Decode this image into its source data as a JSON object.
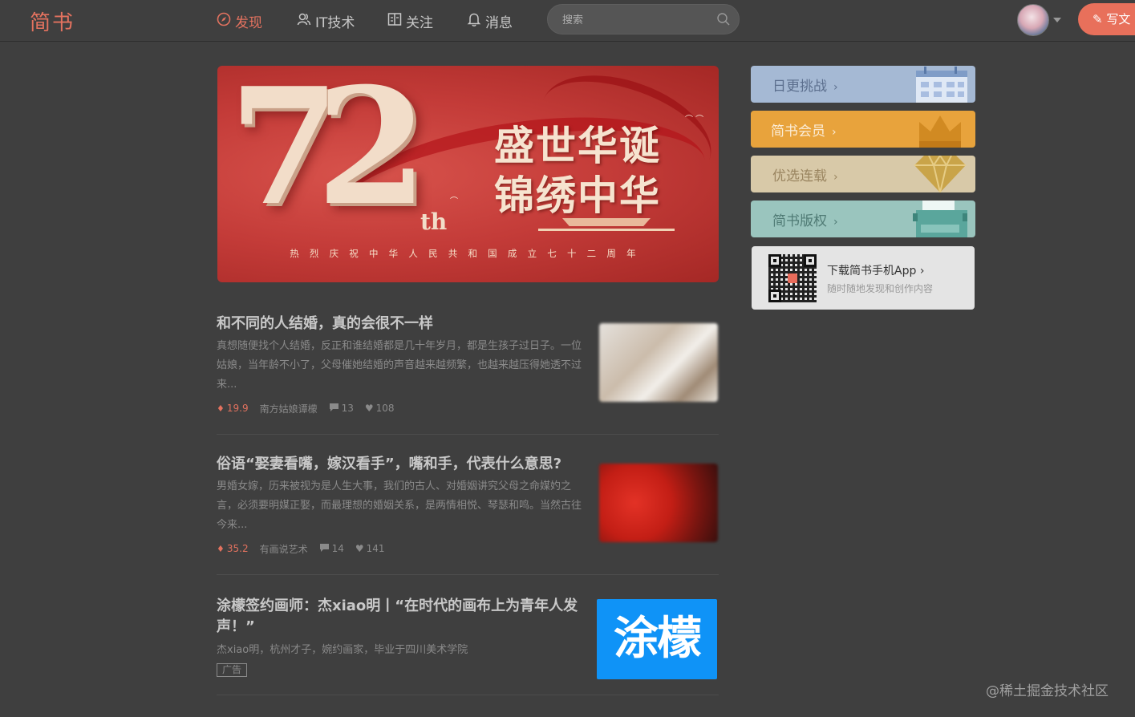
{
  "header": {
    "logo": "简书",
    "nav": [
      {
        "label": "发现",
        "icon": "compass-icon"
      },
      {
        "label": "IT技术",
        "icon": "users-icon"
      },
      {
        "label": "关注",
        "icon": "book-icon"
      },
      {
        "label": "消息",
        "icon": "bell-icon"
      }
    ],
    "search_placeholder": "搜索",
    "write_label": "写文"
  },
  "banner": {
    "number": "72",
    "number_suffix": "th",
    "title_line1": "盛世华诞",
    "title_line2": "锦绣中华",
    "subtitle": "热烈庆祝中华人民共和国成立七十二周年"
  },
  "articles": [
    {
      "title": "和不同的人结婚，真的会很不一样",
      "abstract": "真想随便找个人结婚，反正和谁结婚都是几十年岁月，都是生孩子过日子。一位姑娘，当年龄不小了，父母催她结婚的声音越来越频繁，也越来越压得她透不过来...",
      "money": "19.9",
      "author": "南方姑娘谭檬",
      "comments": "13",
      "likes": "108"
    },
    {
      "title": "俗语“娶妻看嘴，嫁汉看手”，嘴和手，代表什么意思?",
      "abstract": "男婚女嫁，历来被视为是人生大事，我们的古人、对婚姻讲究父母之命媒妁之言，必须要明媒正娶，而最理想的婚姻关系，是两情相悦、琴瑟和鸣。当然古往今来...",
      "money": "35.2",
      "author": "有画说艺术",
      "comments": "14",
      "likes": "141"
    }
  ],
  "ad": {
    "title": "涂檬签约画师：杰xiao明丨“在时代的画布上为青年人发声！”",
    "abstract": "杰xiao明，杭州才子，婉约画家，毕业于四川美术学院",
    "tag": "广告",
    "logo_text": "涂檬"
  },
  "sidebar": {
    "buttons": [
      {
        "label": "日更挑战"
      },
      {
        "label": "简书会员"
      },
      {
        "label": "优选连载"
      },
      {
        "label": "简书版权"
      }
    ],
    "chevron": "›",
    "app_title": "下载简书手机App",
    "app_sub": "随时随地发现和创作内容",
    "app_chevron": "›"
  },
  "watermark": "@稀土掘金技术社区",
  "colors": {
    "accent": "#e3725f",
    "background": "#3f3f3f",
    "ad_blue": "#0f93f7"
  }
}
